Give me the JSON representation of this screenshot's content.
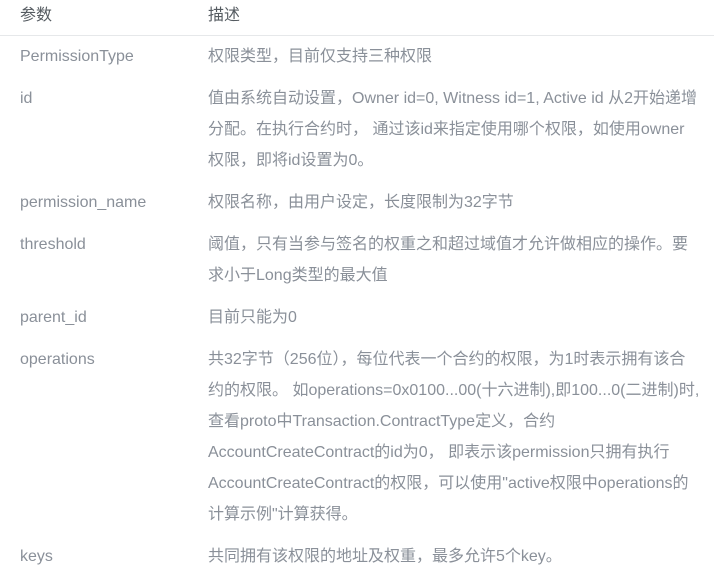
{
  "table": {
    "headers": {
      "param": "参数",
      "desc": "描述"
    },
    "rows": [
      {
        "param": "PermissionType",
        "desc": "权限类型，目前仅支持三种权限"
      },
      {
        "param": "id",
        "desc": "值由系统自动设置，Owner id=0, Witness id=1, Active id 从2开始递增分配。在执行合约时， 通过该id来指定使用哪个权限，如使用owner权限，即将id设置为0。"
      },
      {
        "param": "permission_name",
        "desc": "权限名称，由用户设定，长度限制为32字节"
      },
      {
        "param": "threshold",
        "desc": "阈值，只有当参与签名的权重之和超过域值才允许做相应的操作。要求小于Long类型的最大值"
      },
      {
        "param": "parent_id",
        "desc": "目前只能为0"
      },
      {
        "param": "operations",
        "desc": "共32字节（256位），每位代表一个合约的权限，为1时表示拥有该合约的权限。 如operations=0x0100...00(十六进制),即100...0(二进制)时,查看proto中Transaction.ContractType定义，合约AccountCreateContract的id为0， 即表示该permission只拥有执行AccountCreateContract的权限，可以使用\"active权限中operations的计算示例\"计算获得。"
      },
      {
        "param": "keys",
        "desc": "共同拥有该权限的地址及权重，最多允许5个key。"
      }
    ]
  },
  "colors": {
    "text": "#8a9099",
    "header_text": "#555b61",
    "rule": "#e6e8ea",
    "background": "#ffffff"
  }
}
